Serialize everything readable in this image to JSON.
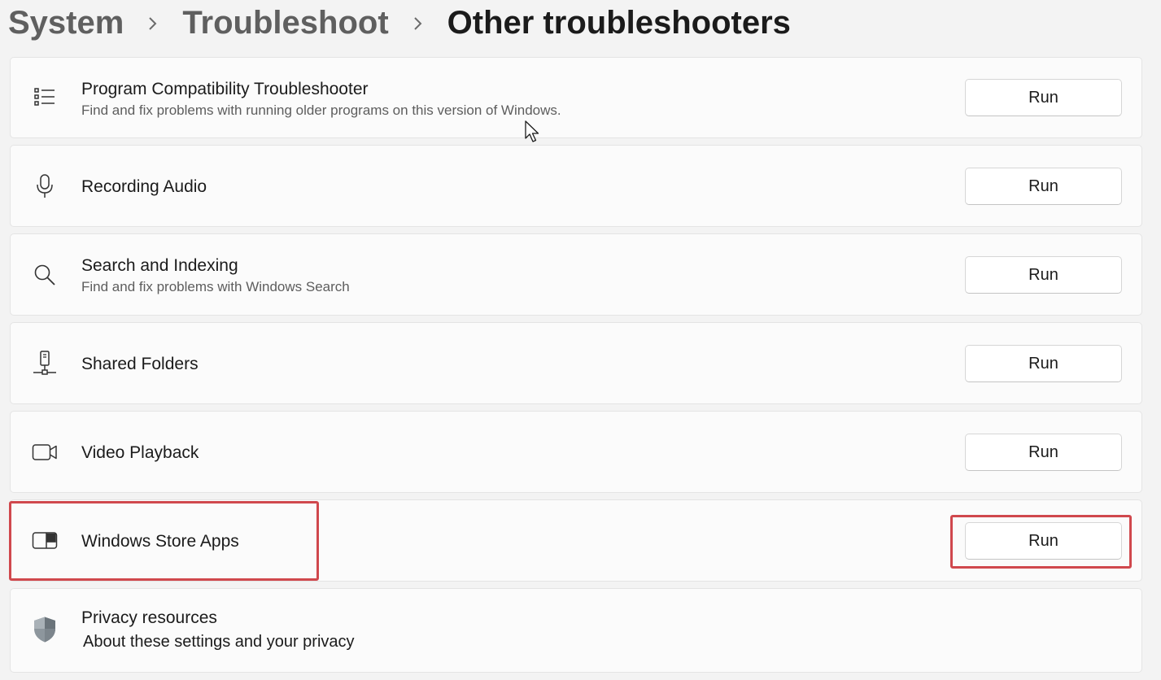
{
  "breadcrumb": {
    "items": [
      "System",
      "Troubleshoot"
    ],
    "current": "Other troubleshooters"
  },
  "troubleshooters": [
    {
      "icon": "list-icon",
      "title": "Program Compatibility Troubleshooter",
      "description": "Find and fix problems with running older programs on this version of Windows.",
      "button": "Run"
    },
    {
      "icon": "microphone-icon",
      "title": "Recording Audio",
      "description": "",
      "button": "Run"
    },
    {
      "icon": "search-icon",
      "title": "Search and Indexing",
      "description": "Find and fix problems with Windows Search",
      "button": "Run"
    },
    {
      "icon": "network-drive-icon",
      "title": "Shared Folders",
      "description": "",
      "button": "Run"
    },
    {
      "icon": "video-camera-icon",
      "title": "Video Playback",
      "description": "",
      "button": "Run"
    },
    {
      "icon": "store-apps-icon",
      "title": "Windows Store Apps",
      "description": "",
      "button": "Run"
    }
  ],
  "privacy": {
    "icon": "shield-icon",
    "title": "Privacy resources",
    "link": "About these settings and your privacy"
  },
  "colors": {
    "highlight": "#d0484d",
    "background": "#f3f3f3",
    "card": "#fbfbfb"
  }
}
